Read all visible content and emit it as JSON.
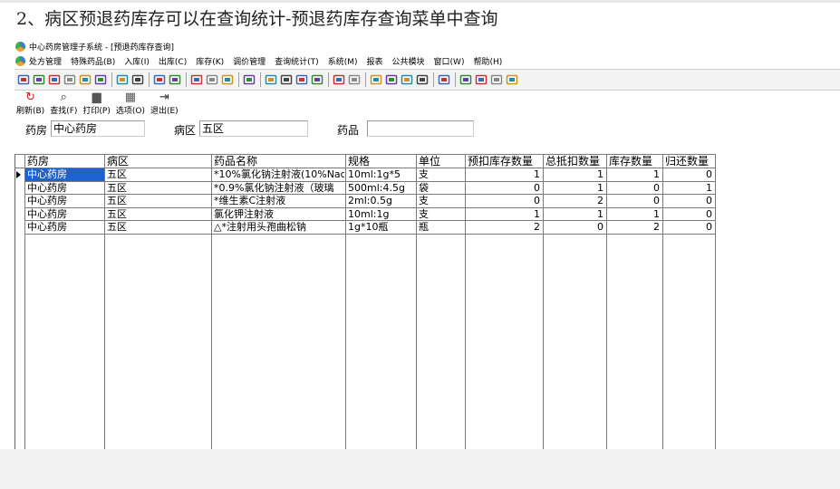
{
  "doc": {
    "heading": "2、病区预退药库存可以在查询统计-预退药库存查询菜单中查询"
  },
  "app": {
    "title": "中心药房管理子系统 - [预退药库存查询]",
    "menus": [
      "处方管理",
      "特殊药品(B)",
      "入库(I)",
      "出库(C)",
      "库存(K)",
      "调价管理",
      "查询统计(T)",
      "系统(M)",
      "报表",
      "公共模块",
      "窗口(W)",
      "帮助(H)"
    ]
  },
  "actions": [
    {
      "label": "刷新(B)",
      "icon": "refresh-icon",
      "glyph": "↻",
      "color": "#d02020"
    },
    {
      "label": "查找(F)",
      "icon": "search-icon",
      "glyph": "⌕",
      "color": "#333333"
    },
    {
      "label": "打印(P)",
      "icon": "printer-icon",
      "glyph": "▆",
      "color": "#555555"
    },
    {
      "label": "选项(O)",
      "icon": "options-icon",
      "glyph": "▦",
      "color": "#555555"
    },
    {
      "label": "退出(E)",
      "icon": "exit-icon",
      "glyph": "⇥",
      "color": "#333333"
    }
  ],
  "filters": {
    "pharmacy_label": "药房",
    "pharmacy_value": "中心药房",
    "ward_label": "病区",
    "ward_value": "五区",
    "drug_label": "药品",
    "drug_value": ""
  },
  "table": {
    "columns": [
      "药房",
      "病区",
      "药品名称",
      "规格",
      "单位",
      "预扣库存数量",
      "总抵扣数量",
      "库存数量",
      "归还数量"
    ],
    "rows": [
      [
        "中心药房",
        "五区",
        "*10%氯化钠注射液(10%Nac",
        "10ml:1g*5",
        "支",
        "1",
        "1",
        "1",
        "0"
      ],
      [
        "中心药房",
        "五区",
        "*0.9%氯化钠注射液（玻璃",
        "500ml:4.5g",
        "袋",
        "0",
        "1",
        "0",
        "1"
      ],
      [
        "中心药房",
        "五区",
        "*维生素C注射液",
        "2ml:0.5g",
        "支",
        "0",
        "2",
        "0",
        "0"
      ],
      [
        "中心药房",
        "五区",
        "氯化钾注射液",
        "10ml:1g",
        "支",
        "1",
        "1",
        "1",
        "0"
      ],
      [
        "中心药房",
        "五区",
        "△*注射用头孢曲松钠",
        "1g*10瓶",
        "瓶",
        "2",
        "0",
        "2",
        "0"
      ]
    ],
    "selected_row": 0
  },
  "toolbar_icons": [
    "icon-1",
    "icon-2",
    "icon-3",
    "icon-4",
    "icon-5",
    "icon-6",
    "icon-7",
    "icon-8",
    "icon-9",
    "icon-10",
    "icon-11",
    "icon-12",
    "icon-13",
    "icon-14",
    "icon-15",
    "icon-16",
    "icon-17",
    "icon-18",
    "icon-19",
    "icon-20",
    "icon-21",
    "icon-22",
    "icon-23",
    "icon-24",
    "icon-25",
    "icon-26",
    "icon-27",
    "icon-28",
    "icon-29"
  ]
}
